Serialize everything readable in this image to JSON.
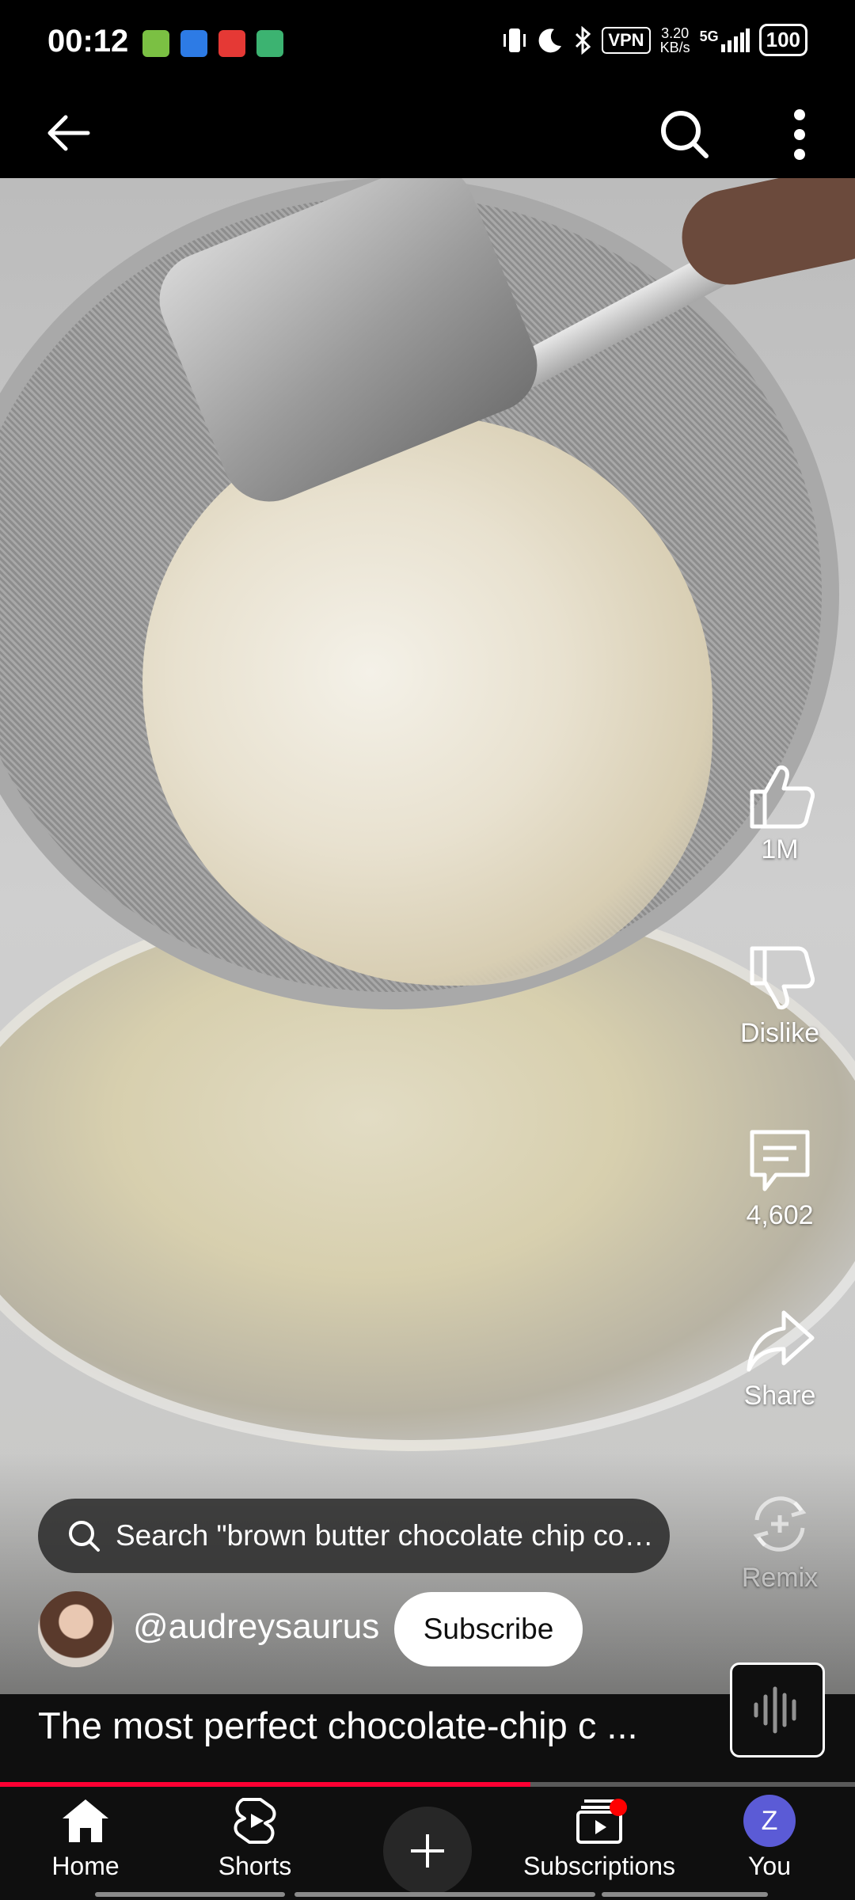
{
  "status_bar": {
    "time": "00:12",
    "vpn": "VPN",
    "speed_value": "3.20",
    "speed_unit": "KB/s",
    "network": "5G",
    "battery": "100"
  },
  "rail": {
    "like_count": "1M",
    "dislike_label": "Dislike",
    "comment_count": "4,602",
    "share_label": "Share",
    "remix_label": "Remix"
  },
  "search": {
    "text": "Search \"brown butter chocolate chip cookies\""
  },
  "channel": {
    "handle": "@audreysaurus",
    "subscribe_label": "Subscribe"
  },
  "video": {
    "title": "The most perfect chocolate-chip c ...",
    "progress": 0.62
  },
  "nav": {
    "home": "Home",
    "shorts": "Shorts",
    "subscriptions": "Subscriptions",
    "you": "You",
    "you_initial": "Z"
  },
  "colors": {
    "accent": "#ff0033",
    "avatar_bg": "#5b5bd6"
  }
}
